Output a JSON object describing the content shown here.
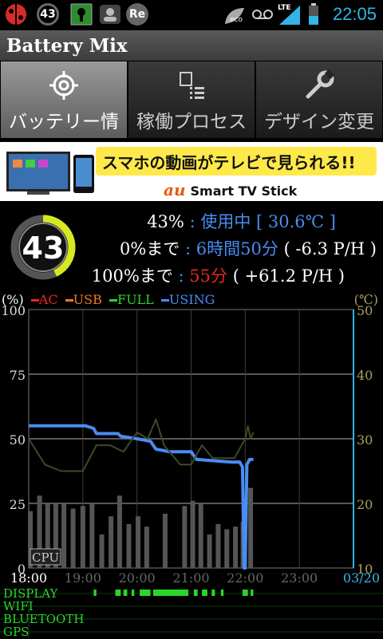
{
  "status_bar": {
    "notification_icons": [
      "ladybug-icon",
      "battery-level-icon",
      "lock-icon",
      "contact-icon",
      "re-icon"
    ],
    "battery_badge": "43",
    "re_badge": "Re",
    "right_icons": [
      "eco-leaf-icon",
      "voicemail-icon",
      "lte-signal-icon",
      "battery-icon"
    ],
    "eco_label": "eco",
    "lte_label": "LTE",
    "time": "22:05"
  },
  "app_title": "Battery Mix",
  "tabs": [
    {
      "label": "バッテリー情",
      "icon": "target-icon",
      "active": true
    },
    {
      "label": "稼働プロセス",
      "icon": "process-list-icon",
      "active": false
    },
    {
      "label": "デザイン変更",
      "icon": "wrench-icon",
      "active": false
    }
  ],
  "ad": {
    "headline": "スマホの動画がテレビで見られる!!",
    "brand": "au",
    "product": "Smart TV Stick"
  },
  "battery": {
    "level": 43,
    "level_text": "43%",
    "sep1": ":",
    "status_text": "使用中 [ 30.6℃ ]",
    "to_empty_label": "0%まで",
    "sep2": ":",
    "to_empty_time": "6時間50分",
    "to_empty_rate": "( -6.3 P/H )",
    "to_full_label": "100%まで",
    "sep3": ":",
    "to_full_time": "55分",
    "to_full_rate": "( +61.2 P/H )"
  },
  "legend": {
    "left_unit": "(%)",
    "items": [
      {
        "label": "AC",
        "color": "#e8281e"
      },
      {
        "label": "USB",
        "color": "#f07a1e"
      },
      {
        "label": "FULL",
        "color": "#2bd629"
      },
      {
        "label": "USING",
        "color": "#4a8cf0"
      }
    ],
    "right_unit": "(℃)"
  },
  "chart_data": {
    "type": "line",
    "x_ticks": [
      "18:00",
      "19:00",
      "20:00",
      "21:00",
      "22:00",
      "23:00"
    ],
    "date_label": "03/20",
    "left_ticks": [
      "100",
      "75",
      "50",
      "25",
      "0"
    ],
    "right_ticks": [
      "50",
      "40",
      "30",
      "20",
      "10"
    ],
    "ylim": [
      0,
      100
    ],
    "y2lim": [
      10,
      50
    ],
    "cpu_label": "CPU",
    "grid": true,
    "series": [
      {
        "name": "USING",
        "color": "#4a8cf0",
        "points": [
          [
            18.0,
            55
          ],
          [
            19.05,
            55
          ],
          [
            19.2,
            54
          ],
          [
            19.25,
            52
          ],
          [
            19.65,
            52
          ],
          [
            19.7,
            51
          ],
          [
            20.0,
            50
          ],
          [
            20.25,
            49
          ],
          [
            20.35,
            46
          ],
          [
            20.6,
            45
          ],
          [
            21.0,
            45
          ],
          [
            21.1,
            42
          ],
          [
            21.75,
            41
          ],
          [
            21.9,
            41
          ],
          [
            21.95,
            39
          ],
          [
            21.98,
            0
          ],
          [
            22.0,
            0
          ],
          [
            22.03,
            40
          ],
          [
            22.08,
            42
          ],
          [
            22.15,
            42
          ]
        ]
      },
      {
        "name": "temperature",
        "color": "#3d4a28",
        "axis": "right",
        "points": [
          [
            18.0,
            30
          ],
          [
            18.3,
            26
          ],
          [
            18.6,
            25
          ],
          [
            19.0,
            25
          ],
          [
            19.25,
            29
          ],
          [
            19.5,
            29
          ],
          [
            19.75,
            28
          ],
          [
            20.0,
            31
          ],
          [
            20.2,
            30
          ],
          [
            20.35,
            33
          ],
          [
            20.5,
            29
          ],
          [
            20.8,
            26
          ],
          [
            21.0,
            26
          ],
          [
            21.2,
            29
          ],
          [
            21.4,
            27
          ],
          [
            21.6,
            27
          ],
          [
            21.8,
            27
          ],
          [
            22.0,
            30
          ],
          [
            22.05,
            32
          ],
          [
            22.1,
            30
          ],
          [
            22.15,
            31
          ]
        ]
      }
    ],
    "cpu_bars": [
      {
        "x": 18.03,
        "value": 22
      },
      {
        "x": 18.2,
        "value": 28
      },
      {
        "x": 18.35,
        "value": 25
      },
      {
        "x": 18.5,
        "value": 25
      },
      {
        "x": 18.65,
        "value": 25
      },
      {
        "x": 18.82,
        "value": 23
      },
      {
        "x": 19.0,
        "value": 24
      },
      {
        "x": 19.17,
        "value": 25
      },
      {
        "x": 19.35,
        "value": 13
      },
      {
        "x": 19.52,
        "value": 20
      },
      {
        "x": 19.68,
        "value": 28
      },
      {
        "x": 19.85,
        "value": 17
      },
      {
        "x": 20.02,
        "value": 20
      },
      {
        "x": 20.18,
        "value": 16
      },
      {
        "x": 20.52,
        "value": 21
      },
      {
        "x": 20.88,
        "value": 24
      },
      {
        "x": 21.03,
        "value": 26
      },
      {
        "x": 21.18,
        "value": 25
      },
      {
        "x": 21.34,
        "value": 13
      },
      {
        "x": 21.5,
        "value": 17
      },
      {
        "x": 21.66,
        "value": 15
      },
      {
        "x": 21.82,
        "value": 16
      },
      {
        "x": 21.96,
        "value": 18
      },
      {
        "x": 22.1,
        "value": 31
      }
    ]
  },
  "sensors": {
    "labels": [
      "DISPLAY",
      "WIFI",
      "BLUETOOTH",
      "GPS"
    ],
    "display_on": [
      [
        19.2,
        19.25
      ],
      [
        19.6,
        19.7
      ],
      [
        19.75,
        19.82
      ],
      [
        19.9,
        19.95
      ],
      [
        20.05,
        20.25
      ],
      [
        20.3,
        20.95
      ],
      [
        21.05,
        21.12
      ],
      [
        21.2,
        21.3
      ],
      [
        21.38,
        21.44
      ],
      [
        21.55,
        21.6
      ],
      [
        21.95,
        22.05
      ],
      [
        22.1,
        22.15
      ]
    ]
  }
}
